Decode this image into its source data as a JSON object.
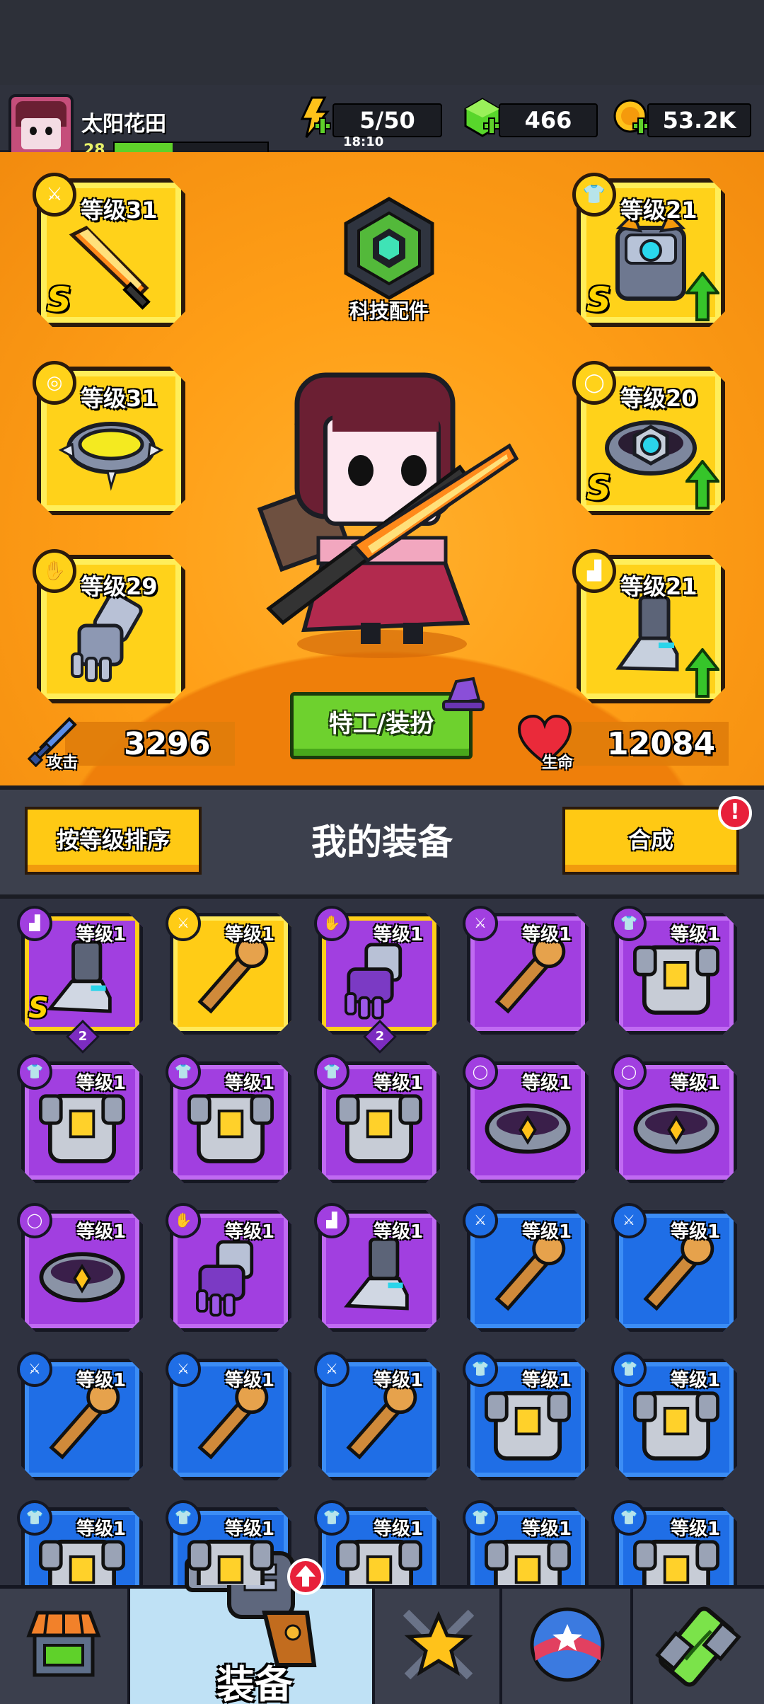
{
  "player": {
    "name": "太阳花田",
    "level": "28",
    "xp_fraction": 0.38
  },
  "resources": {
    "energy": {
      "value": "5/50",
      "timer": "18:10",
      "icon": "lightning-icon"
    },
    "gems": {
      "value": "466",
      "icon": "green-gem-icon"
    },
    "coins": {
      "value": "53.2K",
      "icon": "gold-coin-icon"
    }
  },
  "hero": {
    "tech_label": "科技配件",
    "costume_button": "特工/装扮",
    "attack": {
      "value": "3296",
      "label": "攻击"
    },
    "health": {
      "value": "12084",
      "label": "生命"
    },
    "slots": [
      {
        "level": "等级31",
        "rank": "S",
        "type": "weapon",
        "upgradable": false
      },
      {
        "level": "等级31",
        "rank": "",
        "type": "necklace",
        "upgradable": false
      },
      {
        "level": "等级29",
        "rank": "",
        "type": "gloves",
        "upgradable": false
      },
      {
        "level": "等级21",
        "rank": "S",
        "type": "armor",
        "upgradable": true
      },
      {
        "level": "等级20",
        "rank": "S",
        "type": "belt",
        "upgradable": true
      },
      {
        "level": "等级21",
        "rank": "",
        "type": "boots",
        "upgradable": true
      }
    ]
  },
  "equipment": {
    "title": "我的装备",
    "sort_button": "按等级排序",
    "merge_button": "合成",
    "merge_alert": "!",
    "items": [
      {
        "level": "等级1",
        "tier": "goldframe",
        "slot": "boots",
        "rank": "S",
        "count": "2"
      },
      {
        "level": "等级1",
        "tier": "gold",
        "slot": "weapon",
        "rank": "",
        "count": ""
      },
      {
        "level": "等级1",
        "tier": "goldframe",
        "slot": "gloves",
        "rank": "",
        "count": "2"
      },
      {
        "level": "等级1",
        "tier": "purple",
        "slot": "weapon",
        "rank": "",
        "count": ""
      },
      {
        "level": "等级1",
        "tier": "purple",
        "slot": "armor",
        "rank": "",
        "count": ""
      },
      {
        "level": "等级1",
        "tier": "purple",
        "slot": "armor",
        "rank": "",
        "count": ""
      },
      {
        "level": "等级1",
        "tier": "purple",
        "slot": "armor",
        "rank": "",
        "count": ""
      },
      {
        "level": "等级1",
        "tier": "purple",
        "slot": "armor",
        "rank": "",
        "count": ""
      },
      {
        "level": "等级1",
        "tier": "purple",
        "slot": "belt",
        "rank": "",
        "count": ""
      },
      {
        "level": "等级1",
        "tier": "purple",
        "slot": "belt",
        "rank": "",
        "count": ""
      },
      {
        "level": "等级1",
        "tier": "purple",
        "slot": "belt",
        "rank": "",
        "count": ""
      },
      {
        "level": "等级1",
        "tier": "purple",
        "slot": "gloves",
        "rank": "",
        "count": ""
      },
      {
        "level": "等级1",
        "tier": "purple",
        "slot": "boots",
        "rank": "",
        "count": ""
      },
      {
        "level": "等级1",
        "tier": "blue",
        "slot": "weapon",
        "rank": "",
        "count": ""
      },
      {
        "level": "等级1",
        "tier": "blue",
        "slot": "weapon",
        "rank": "",
        "count": ""
      },
      {
        "level": "等级1",
        "tier": "blue",
        "slot": "weapon",
        "rank": "",
        "count": ""
      },
      {
        "level": "等级1",
        "tier": "blue",
        "slot": "weapon",
        "rank": "",
        "count": ""
      },
      {
        "level": "等级1",
        "tier": "blue",
        "slot": "weapon",
        "rank": "",
        "count": ""
      },
      {
        "level": "等级1",
        "tier": "blue",
        "slot": "armor",
        "rank": "",
        "count": ""
      },
      {
        "level": "等级1",
        "tier": "blue",
        "slot": "armor",
        "rank": "",
        "count": ""
      },
      {
        "level": "等级1",
        "tier": "blue",
        "slot": "armor",
        "rank": "",
        "count": ""
      },
      {
        "level": "等级1",
        "tier": "blue",
        "slot": "armor",
        "rank": "",
        "count": ""
      },
      {
        "level": "等级1",
        "tier": "blue",
        "slot": "armor",
        "rank": "",
        "count": ""
      },
      {
        "level": "等级1",
        "tier": "blue",
        "slot": "armor",
        "rank": "",
        "count": ""
      },
      {
        "level": "等级1",
        "tier": "blue",
        "slot": "armor",
        "rank": "",
        "count": ""
      }
    ]
  },
  "nav": {
    "active_label": "装备",
    "tabs": [
      {
        "name": "shop",
        "icon": "shop-icon"
      },
      {
        "name": "equipment",
        "icon": "revolver-icon"
      },
      {
        "name": "battle",
        "icon": "star-swords-icon"
      },
      {
        "name": "world",
        "icon": "star-ball-icon"
      },
      {
        "name": "lab",
        "icon": "dna-capsule-icon"
      }
    ]
  },
  "colors": {
    "hero_bg": "#ff9f17",
    "slot_gold": "#ffd21a",
    "tier_purple": "#a13fe0",
    "tier_blue": "#1f6ee6",
    "button_green": "#6ed12e",
    "alert_red": "#e8203a"
  }
}
